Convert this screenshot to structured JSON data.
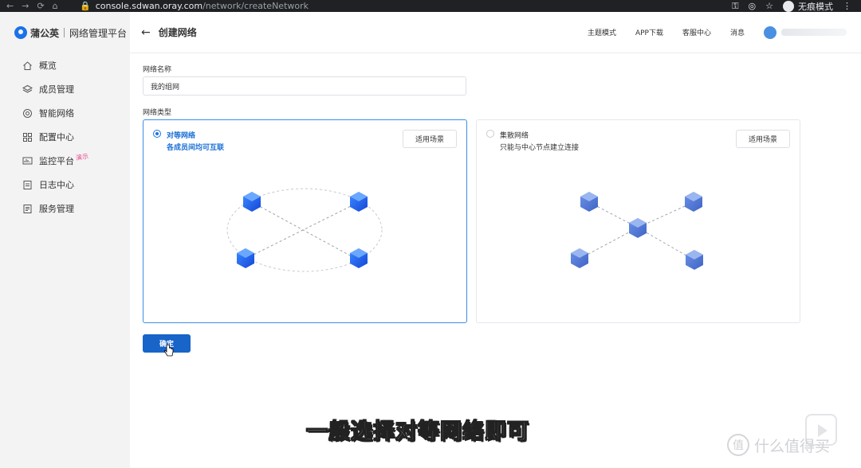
{
  "browser": {
    "host": "console.sdwan.oray.com",
    "path": "/network/createNetwork",
    "incognito_label": "无痕模式"
  },
  "brand": {
    "name": "蒲公英",
    "subtitle": "网络管理平台"
  },
  "sidebar": {
    "items": [
      {
        "label": "概览",
        "icon": "home-icon"
      },
      {
        "label": "成员管理",
        "icon": "layers-icon"
      },
      {
        "label": "智能网络",
        "icon": "network-icon"
      },
      {
        "label": "配置中心",
        "icon": "grid-icon"
      },
      {
        "label": "监控平台",
        "icon": "monitor-icon",
        "badge": "演示"
      },
      {
        "label": "日志中心",
        "icon": "document-icon"
      },
      {
        "label": "服务管理",
        "icon": "list-icon"
      }
    ]
  },
  "header": {
    "title": "创建网络",
    "links": [
      "主题模式",
      "APP下载",
      "客服中心",
      "消息"
    ]
  },
  "form": {
    "name_label": "网络名称",
    "name_value": "我的组网",
    "type_label": "网络类型",
    "options": [
      {
        "title": "对等网络",
        "desc": "各成员间均可互联",
        "button": "适用场景",
        "selected": true
      },
      {
        "title": "集散网络",
        "desc": "只能与中心节点建立连接",
        "button": "适用场景",
        "selected": false
      }
    ],
    "confirm_label": "确定"
  },
  "overlay": {
    "subtitle": "一般选择对等网络即可",
    "watermark": "什么值得买",
    "watermark_logo": "值"
  },
  "colors": {
    "primary": "#1864c8",
    "selected_border": "#3a8ee6",
    "sidebar_bg": "#f3f3f4",
    "badge": "#e8478b"
  }
}
